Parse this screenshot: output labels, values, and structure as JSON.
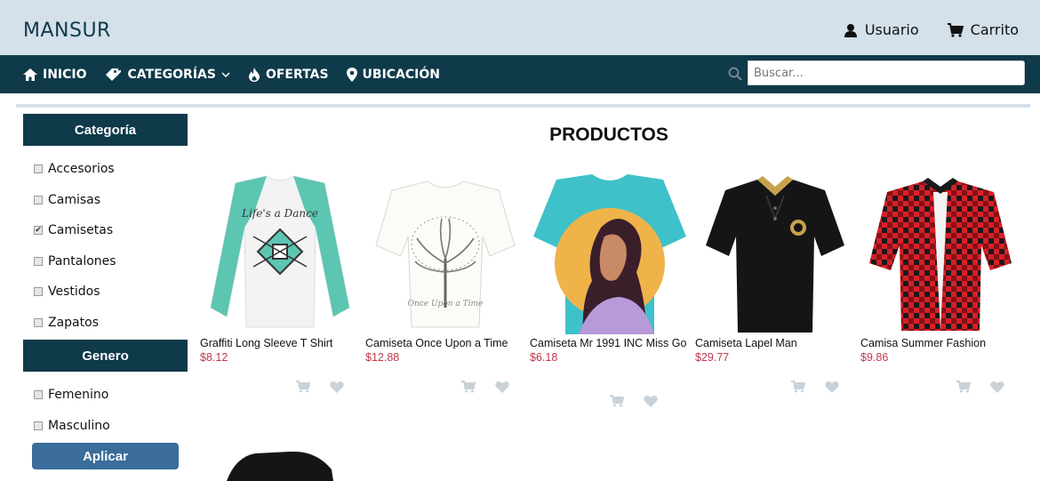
{
  "header": {
    "logo": "MANSUR",
    "user_label": "Usuario",
    "cart_label": "Carrito"
  },
  "nav": {
    "items": [
      {
        "label": "INICIO",
        "icon": "home-icon"
      },
      {
        "label": "CATEGORÍAS",
        "icon": "tag-icon"
      },
      {
        "label": "OFERTAS",
        "icon": "fire-icon"
      },
      {
        "label": "UBICACIÓN",
        "icon": "map-marker-icon"
      }
    ],
    "search_placeholder": "Buscar..."
  },
  "sidebar": {
    "category_title": "Categoría",
    "categories": [
      {
        "label": "Accesorios",
        "checked": false
      },
      {
        "label": "Camisas",
        "checked": false
      },
      {
        "label": "Camisetas",
        "checked": true
      },
      {
        "label": "Pantalones",
        "checked": false
      },
      {
        "label": "Vestidos",
        "checked": false
      },
      {
        "label": "Zapatos",
        "checked": false
      }
    ],
    "gender_title": "Genero",
    "genders": [
      {
        "label": "Femenino",
        "checked": false
      },
      {
        "label": "Masculino",
        "checked": false
      }
    ],
    "apply_label": "Aplicar"
  },
  "main": {
    "heading": "PRODUCTOS",
    "products": [
      {
        "name": "Graffiti Long Sleeve T Shirt",
        "price": "$8.12"
      },
      {
        "name": "Camiseta Once Upon a Time",
        "price": "$12.88"
      },
      {
        "name": "Camiseta Mr 1991 INC Miss Go",
        "price": "$6.18"
      },
      {
        "name": "Camiseta Lapel Man",
        "price": "$29.77"
      },
      {
        "name": "Camisa Summer Fashion",
        "price": "$9.86"
      }
    ]
  },
  "colors": {
    "navy": "#0f3a4a",
    "topbar": "#d4e0ea",
    "price": "#c0394b",
    "apply": "#3a6d9a"
  }
}
